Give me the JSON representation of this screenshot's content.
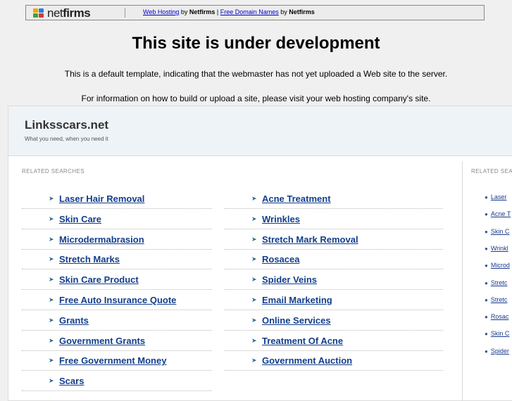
{
  "topbar": {
    "brand_icon": "netfirms-logo",
    "brand_first": "net",
    "brand_second": "firms",
    "link1": "Web Hosting",
    "by1": " by ",
    "brand1": "Netfirms",
    "sep": " | ",
    "link2": "Free Domain Names",
    "by2": " by ",
    "brand2": "Netfirms"
  },
  "heading": "This site is under development",
  "notice1": "This is a default template, indicating that the webmaster has not yet uploaded a Web site to the server.",
  "notice2": "For information on how to build or upload a site, please visit your web hosting company's site.",
  "site": {
    "title": "Linksscars.net",
    "tagline": "What you need, when you need it"
  },
  "related_label": "RELATED SEARCHES",
  "related_label_side": "RELATED SEA",
  "left_links": [
    "Laser Hair Removal",
    "Skin Care",
    "Microdermabrasion",
    "Stretch Marks",
    "Skin Care Product",
    "Free Auto Insurance Quote",
    "Grants",
    "Government Grants",
    "Free Government Money",
    "Scars"
  ],
  "right_links": [
    "Acne Treatment",
    "Wrinkles",
    "Stretch Mark Removal",
    "Rosacea",
    "Spider Veins",
    "Email Marketing",
    "Online Services",
    "Treatment Of Acne",
    "Government Auction"
  ],
  "side_links": [
    "Laser",
    "Acne T",
    "Skin C",
    "Wrinkl",
    "Microd",
    "Stretc",
    "Stretc",
    "Rosac",
    "Skin C",
    "Spider"
  ],
  "colors": {
    "link": "#123e8c",
    "header_bg": "#eef3f7",
    "arrow": "#2c6a8a"
  }
}
